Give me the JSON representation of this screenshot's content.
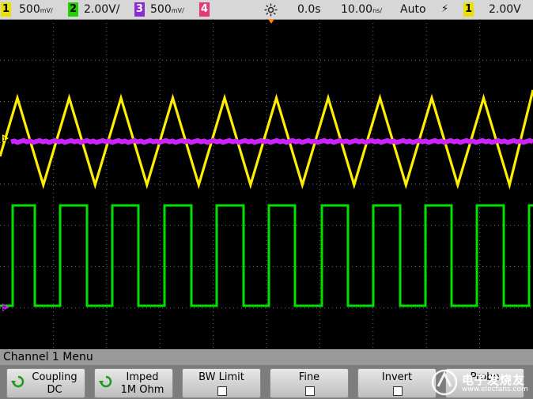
{
  "status": {
    "ch1": {
      "num": "1",
      "scale": "500",
      "unit": "mV/",
      "color": "#e9e000"
    },
    "ch2": {
      "num": "2",
      "scale": "2.00V/",
      "color": "#22d000"
    },
    "ch3": {
      "num": "3",
      "scale": "500",
      "unit": "mV/",
      "color": "#8a2bd0"
    },
    "ch4": {
      "num": "4",
      "color": "#e03a78"
    },
    "time_delay": "0.0s",
    "time_scale": "10.00",
    "time_unit": "ns/",
    "trigger_mode": "Auto",
    "trigger_slope_glyph": "⚡",
    "trigger_source": "1",
    "trigger_level": "2.00V"
  },
  "screen": {
    "ch1_marker": "1",
    "ch2_marker": "2",
    "colors": {
      "ch1": "#ffee00",
      "ch2": "#00e000",
      "ch3": "#cc22ff"
    }
  },
  "menu": {
    "title": "Channel 1  Menu",
    "softkeys": [
      {
        "label": "Coupling",
        "value": "DC"
      },
      {
        "label": "Imped",
        "value": "1M Ohm"
      },
      {
        "label": "BW Limit"
      },
      {
        "label": "Fine"
      },
      {
        "label": "Invert"
      },
      {
        "label": "Probe"
      }
    ]
  },
  "logo": {
    "text": "电子发烧友",
    "url": "www.elecfans.com"
  }
}
